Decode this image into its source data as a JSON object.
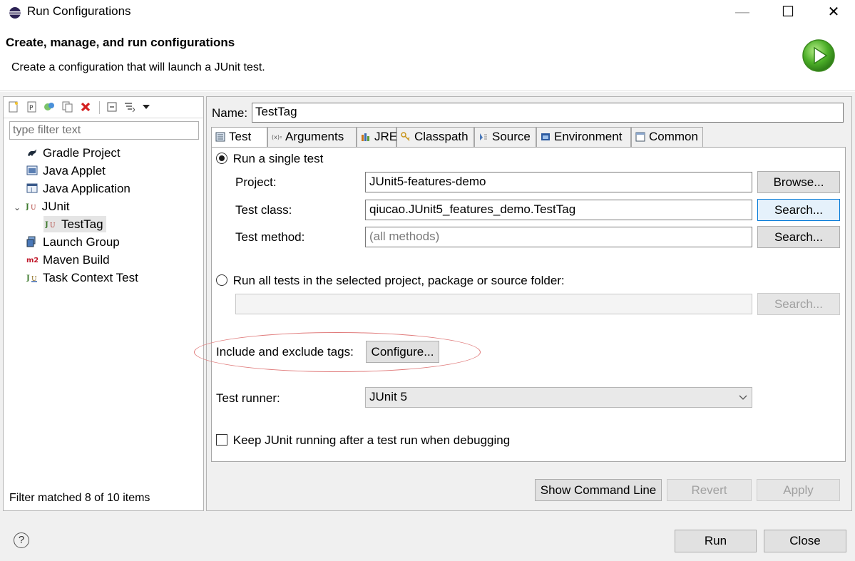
{
  "window": {
    "title": "Run Configurations",
    "minimize_glyph": "—",
    "maximize_glyph": "☐",
    "close_glyph": "✕"
  },
  "header": {
    "title": "Create, manage, and run configurations",
    "description": "Create a configuration that will launch a JUnit test."
  },
  "left": {
    "filter_placeholder": "type filter text",
    "tree": [
      {
        "label": "Gradle Project",
        "icon": "gradle-icon"
      },
      {
        "label": "Java Applet",
        "icon": "java-applet-icon"
      },
      {
        "label": "Java Application",
        "icon": "java-application-icon"
      },
      {
        "label": "JUnit",
        "icon": "junit-icon",
        "expanded": true
      },
      {
        "label": "TestTag",
        "icon": "junit-icon",
        "selected": true
      },
      {
        "label": "Launch Group",
        "icon": "launch-group-icon"
      },
      {
        "label": "Maven Build",
        "icon": "maven-icon"
      },
      {
        "label": "Task Context Test",
        "icon": "task-context-icon"
      }
    ],
    "status": "Filter matched 8 of 10 items"
  },
  "right": {
    "name_label": "Name:",
    "name_value": "TestTag",
    "tabs": [
      "Test",
      "Arguments",
      "JRE",
      "Classpath",
      "Source",
      "Environment",
      "Common"
    ],
    "single_test_label": "Run a single test",
    "project_label": "Project:",
    "project_value": "JUnit5-features-demo",
    "browse_label": "Browse...",
    "test_class_label": "Test class:",
    "test_class_value": "qiucao.JUnit5_features_demo.TestTag",
    "search_label": "Search...",
    "test_method_label": "Test method:",
    "test_method_placeholder": "(all methods)",
    "all_tests_label": "Run all tests in the selected project, package or source folder:",
    "tags_label": "Include and exclude tags:",
    "configure_label": "Configure...",
    "runner_label": "Test runner:",
    "runner_value": "JUnit 5",
    "keep_running_label": "Keep JUnit running after a test run when debugging",
    "show_cmd_label": "Show Command Line",
    "revert_label": "Revert",
    "apply_label": "Apply"
  },
  "footer": {
    "help_glyph": "?",
    "run_label": "Run",
    "close_label": "Close"
  },
  "colors": {
    "accent": "#0078d7",
    "annotation": "#e07a7a",
    "selection": "#e5e5e5"
  }
}
